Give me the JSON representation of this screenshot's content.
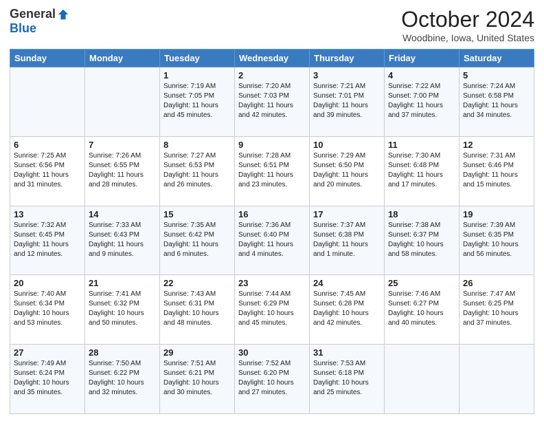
{
  "header": {
    "logo_general": "General",
    "logo_blue": "Blue",
    "month_title": "October 2024",
    "location": "Woodbine, Iowa, United States"
  },
  "days_of_week": [
    "Sunday",
    "Monday",
    "Tuesday",
    "Wednesday",
    "Thursday",
    "Friday",
    "Saturday"
  ],
  "weeks": [
    [
      {
        "day": "",
        "info": ""
      },
      {
        "day": "",
        "info": ""
      },
      {
        "day": "1",
        "sunrise": "7:19 AM",
        "sunset": "7:05 PM",
        "daylight": "11 hours and 45 minutes."
      },
      {
        "day": "2",
        "sunrise": "7:20 AM",
        "sunset": "7:03 PM",
        "daylight": "11 hours and 42 minutes."
      },
      {
        "day": "3",
        "sunrise": "7:21 AM",
        "sunset": "7:01 PM",
        "daylight": "11 hours and 39 minutes."
      },
      {
        "day": "4",
        "sunrise": "7:22 AM",
        "sunset": "7:00 PM",
        "daylight": "11 hours and 37 minutes."
      },
      {
        "day": "5",
        "sunrise": "7:24 AM",
        "sunset": "6:58 PM",
        "daylight": "11 hours and 34 minutes."
      }
    ],
    [
      {
        "day": "6",
        "sunrise": "7:25 AM",
        "sunset": "6:56 PM",
        "daylight": "11 hours and 31 minutes."
      },
      {
        "day": "7",
        "sunrise": "7:26 AM",
        "sunset": "6:55 PM",
        "daylight": "11 hours and 28 minutes."
      },
      {
        "day": "8",
        "sunrise": "7:27 AM",
        "sunset": "6:53 PM",
        "daylight": "11 hours and 26 minutes."
      },
      {
        "day": "9",
        "sunrise": "7:28 AM",
        "sunset": "6:51 PM",
        "daylight": "11 hours and 23 minutes."
      },
      {
        "day": "10",
        "sunrise": "7:29 AM",
        "sunset": "6:50 PM",
        "daylight": "11 hours and 20 minutes."
      },
      {
        "day": "11",
        "sunrise": "7:30 AM",
        "sunset": "6:48 PM",
        "daylight": "11 hours and 17 minutes."
      },
      {
        "day": "12",
        "sunrise": "7:31 AM",
        "sunset": "6:46 PM",
        "daylight": "11 hours and 15 minutes."
      }
    ],
    [
      {
        "day": "13",
        "sunrise": "7:32 AM",
        "sunset": "6:45 PM",
        "daylight": "11 hours and 12 minutes."
      },
      {
        "day": "14",
        "sunrise": "7:33 AM",
        "sunset": "6:43 PM",
        "daylight": "11 hours and 9 minutes."
      },
      {
        "day": "15",
        "sunrise": "7:35 AM",
        "sunset": "6:42 PM",
        "daylight": "11 hours and 6 minutes."
      },
      {
        "day": "16",
        "sunrise": "7:36 AM",
        "sunset": "6:40 PM",
        "daylight": "11 hours and 4 minutes."
      },
      {
        "day": "17",
        "sunrise": "7:37 AM",
        "sunset": "6:38 PM",
        "daylight": "11 hours and 1 minute."
      },
      {
        "day": "18",
        "sunrise": "7:38 AM",
        "sunset": "6:37 PM",
        "daylight": "10 hours and 58 minutes."
      },
      {
        "day": "19",
        "sunrise": "7:39 AM",
        "sunset": "6:35 PM",
        "daylight": "10 hours and 56 minutes."
      }
    ],
    [
      {
        "day": "20",
        "sunrise": "7:40 AM",
        "sunset": "6:34 PM",
        "daylight": "10 hours and 53 minutes."
      },
      {
        "day": "21",
        "sunrise": "7:41 AM",
        "sunset": "6:32 PM",
        "daylight": "10 hours and 50 minutes."
      },
      {
        "day": "22",
        "sunrise": "7:43 AM",
        "sunset": "6:31 PM",
        "daylight": "10 hours and 48 minutes."
      },
      {
        "day": "23",
        "sunrise": "7:44 AM",
        "sunset": "6:29 PM",
        "daylight": "10 hours and 45 minutes."
      },
      {
        "day": "24",
        "sunrise": "7:45 AM",
        "sunset": "6:28 PM",
        "daylight": "10 hours and 42 minutes."
      },
      {
        "day": "25",
        "sunrise": "7:46 AM",
        "sunset": "6:27 PM",
        "daylight": "10 hours and 40 minutes."
      },
      {
        "day": "26",
        "sunrise": "7:47 AM",
        "sunset": "6:25 PM",
        "daylight": "10 hours and 37 minutes."
      }
    ],
    [
      {
        "day": "27",
        "sunrise": "7:49 AM",
        "sunset": "6:24 PM",
        "daylight": "10 hours and 35 minutes."
      },
      {
        "day": "28",
        "sunrise": "7:50 AM",
        "sunset": "6:22 PM",
        "daylight": "10 hours and 32 minutes."
      },
      {
        "day": "29",
        "sunrise": "7:51 AM",
        "sunset": "6:21 PM",
        "daylight": "10 hours and 30 minutes."
      },
      {
        "day": "30",
        "sunrise": "7:52 AM",
        "sunset": "6:20 PM",
        "daylight": "10 hours and 27 minutes."
      },
      {
        "day": "31",
        "sunrise": "7:53 AM",
        "sunset": "6:18 PM",
        "daylight": "10 hours and 25 minutes."
      },
      {
        "day": "",
        "info": ""
      },
      {
        "day": "",
        "info": ""
      }
    ]
  ]
}
